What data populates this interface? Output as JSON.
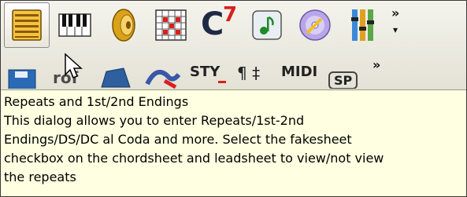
{
  "toolbar": {
    "row1_icons": [
      "repeats-icon",
      "piano-icon",
      "speaker-icon",
      "grid-icon",
      "chord-icon",
      "music-note-icon",
      "disc-icon",
      "mixer-icon"
    ],
    "chord_label": "C",
    "chord_sup": "7",
    "more_symbol": "»",
    "more_dropdown": "▾",
    "row2_labels": {
      "sty": "STY",
      "midi": "MIDI",
      "sp": "SP",
      "prof": "rof"
    }
  },
  "tooltip": {
    "title": "Repeats and 1st/2nd Endings",
    "lines": [
      "This dialog allows you to enter Repeats/1st-2nd",
      "Endings/DS/DC al Coda and more. Select the fakesheet",
      "checkbox on the chordsheet and leadsheet to view/not view",
      "the repeats"
    ]
  }
}
